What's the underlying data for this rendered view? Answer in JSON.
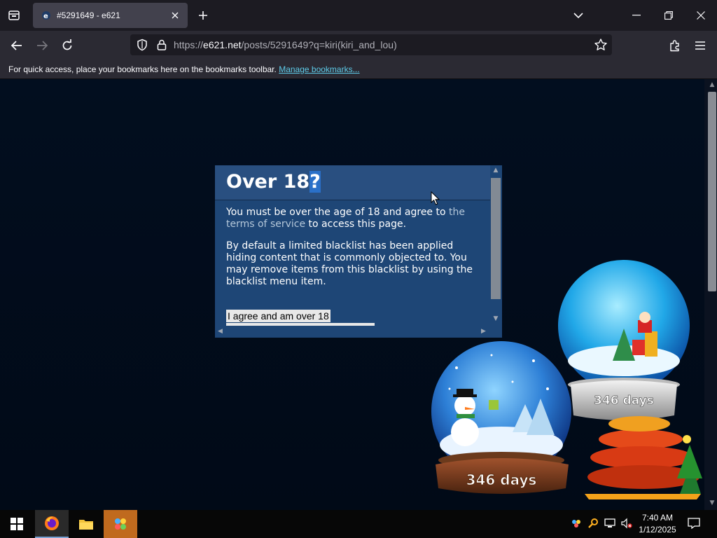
{
  "browser": {
    "tab": {
      "title": "#5291649 - e621"
    },
    "url": {
      "scheme": "https://",
      "host": "e621.net",
      "path": "/posts/5291649?q=kiri(kiri_and_lou)"
    },
    "bookmarks": {
      "hint": "For quick access, place your bookmarks here on the bookmarks toolbar.",
      "manage_link": "Manage bookmarks..."
    }
  },
  "dialog": {
    "title": "Over 18",
    "title_selected_char": "?",
    "paragraph1_pre": "You must be over the age of 18 and agree to",
    "paragraph1_link": "the terms of service",
    "paragraph1_post": "to access this page.",
    "paragraph2": "By default a limited blacklist has been applied hiding content that is commonly objected to. You may remove items from this blacklist by using the blacklist menu item.",
    "agree_button": "I agree and am over 18"
  },
  "decorations": {
    "globe_counter": "346 days"
  },
  "taskbar": {
    "time": "7:40 AM",
    "date": "1/12/2025"
  },
  "colors": {
    "page_bg": "#020c1c",
    "dialog_bg": "#1e4676",
    "link": "#5ecbe8",
    "taskbar_orange": "#c06a1e"
  }
}
